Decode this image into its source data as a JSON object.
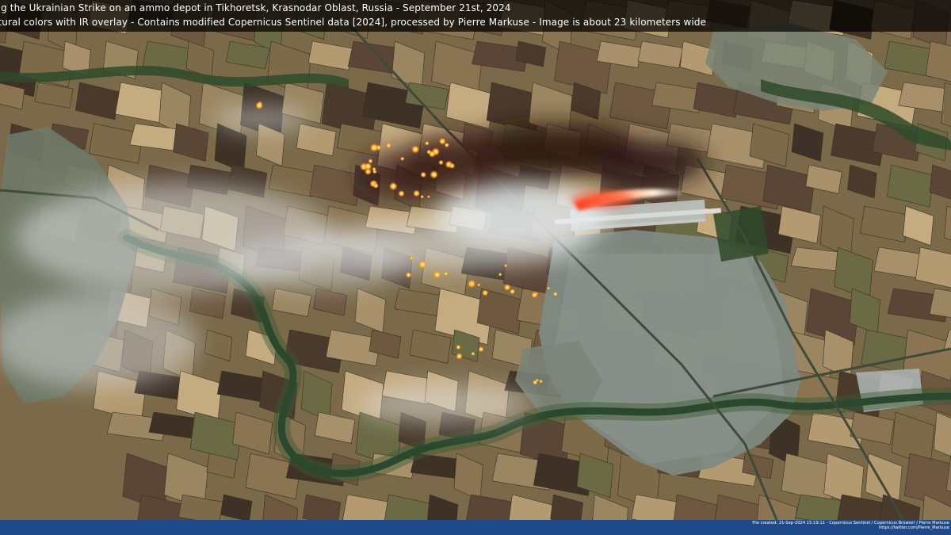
{
  "caption": {
    "line1": "ing the Ukrainian Strike on an ammo depot in Tikhoretsk, Krasnodar Oblast, Russia - September 21st, 2024",
    "line2": "atural colors with IR overlay - Contains modified Copernicus Sentinel data [2024], processed by Pierre Markuse - Image is about 23 kilometers wide"
  },
  "footer": {
    "line1": "File created: 21-Sep-2024 15:19:11 - Copernicus Sentinel / Copernicus Browser / Pierre Markuse",
    "line2": "https://twitter.com/Pierre_Markuse"
  },
  "colors": {
    "caption_bg": "#000000",
    "footer_bg": "#1f4a8a",
    "fire_hot": "#ffd23a",
    "fire_warm": "#ff7a2a",
    "smoke_dark": "#3a1f1a",
    "smoke_white": "#e8ecee",
    "river": "#1d3a2a",
    "town": "#7f8a82"
  }
}
